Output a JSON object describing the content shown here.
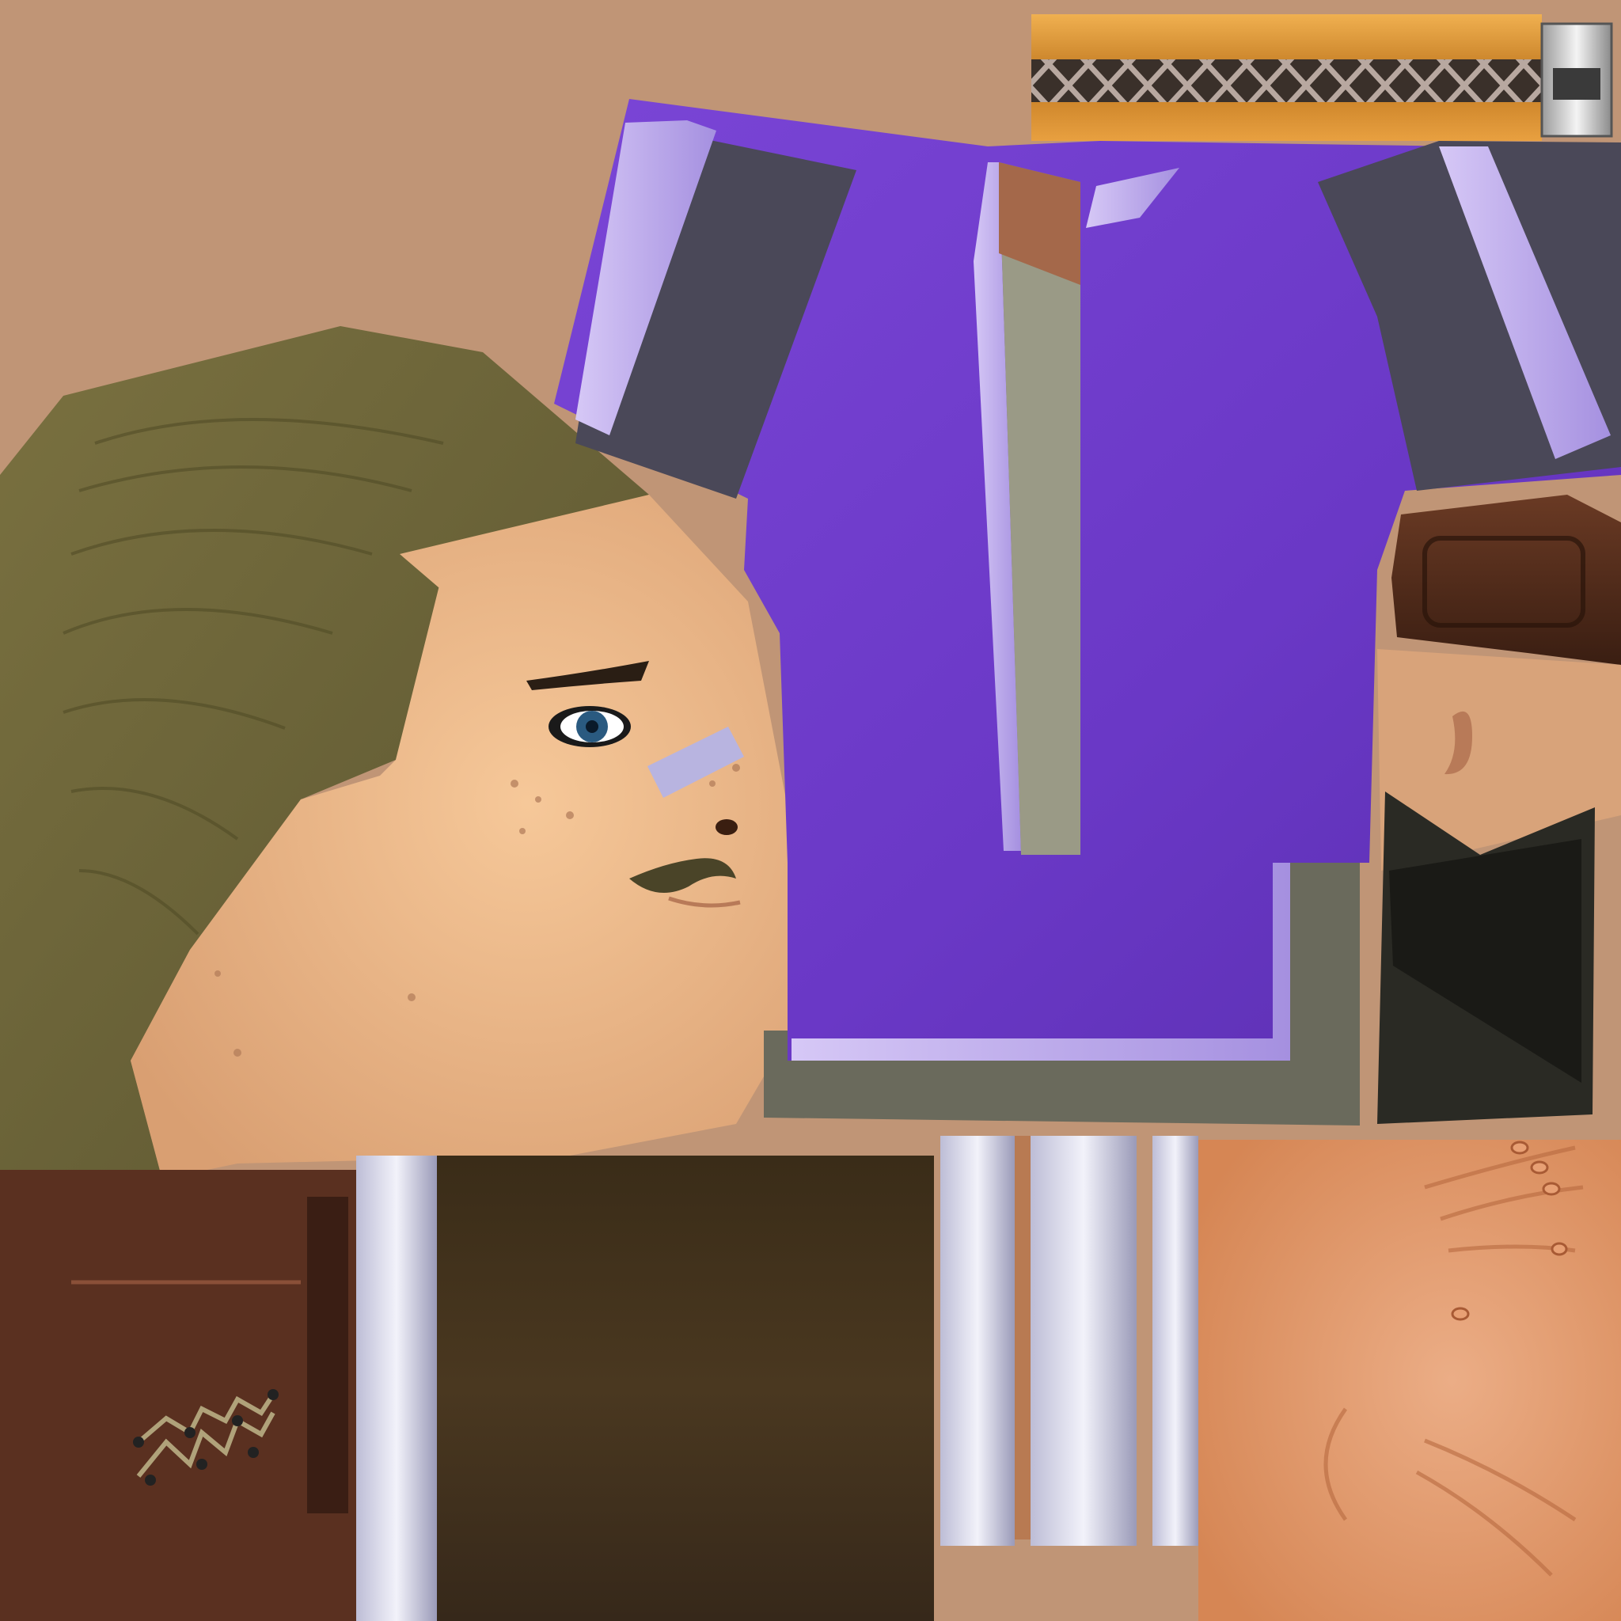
{
  "atlas": {
    "kind": "character texture atlas",
    "palette": {
      "background_skin": "#c09576",
      "hair": "#6d6535",
      "hair_dark": "#4f4a25",
      "face_skin": "#f0bd8d",
      "shirt_purple": "#7340cc",
      "shirt_purple_dark": "#5a2fb0",
      "trim_lavender": "#c7b6f0",
      "sleeve_gray": "#4a4858",
      "undershirt": "#9a9a86",
      "belt_gold": "#d99030",
      "belt_weave": "#3a302a",
      "leather_brown": "#5a3020",
      "pants_dark": "#3e2e18",
      "metal_silver": "#d8d8e8",
      "cuff_olive": "#6a6a5c",
      "boot_black": "#1f1f1a",
      "hand_skin": "#e0955f"
    },
    "regions": [
      {
        "name": "belt-strip",
        "icon": "woven-belt-icon"
      },
      {
        "name": "buckle",
        "icon": "metal-buckle-icon"
      },
      {
        "name": "shirt-torso",
        "icon": "shirt-icon"
      },
      {
        "name": "head-face",
        "icon": "face-icon"
      },
      {
        "name": "hair-cap",
        "icon": "hair-icon"
      },
      {
        "name": "ear-piece",
        "icon": "ear-icon"
      },
      {
        "name": "pouch-top",
        "icon": "pouch-icon"
      },
      {
        "name": "boot-piece",
        "icon": "boot-icon"
      },
      {
        "name": "leather-laced",
        "icon": "laces-icon"
      },
      {
        "name": "pants-panel",
        "icon": "cloth-panel-icon"
      },
      {
        "name": "silver-strips",
        "icon": "metal-strip-icon"
      },
      {
        "name": "hands",
        "icon": "hand-icon"
      }
    ]
  }
}
